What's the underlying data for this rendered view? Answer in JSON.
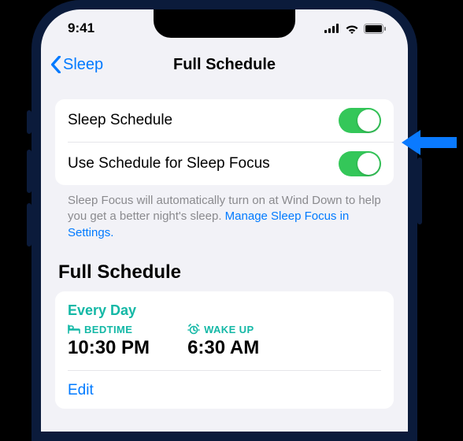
{
  "status": {
    "time": "9:41"
  },
  "nav": {
    "back": "Sleep",
    "title": "Full Schedule"
  },
  "toggles": {
    "sleep_schedule": {
      "label": "Sleep Schedule",
      "on": true
    },
    "use_for_focus": {
      "label": "Use Schedule for Sleep Focus",
      "on": true
    }
  },
  "footer": {
    "text": "Sleep Focus will automatically turn on at Wind Down to help you get a better night's sleep. ",
    "link": "Manage Sleep Focus in Settings."
  },
  "section": {
    "title": "Full Schedule"
  },
  "schedule": {
    "frequency": "Every Day",
    "bedtime": {
      "label": "BEDTIME",
      "time": "10:30 PM"
    },
    "wake": {
      "label": "WAKE UP",
      "time": "6:30 AM"
    },
    "edit": "Edit"
  }
}
